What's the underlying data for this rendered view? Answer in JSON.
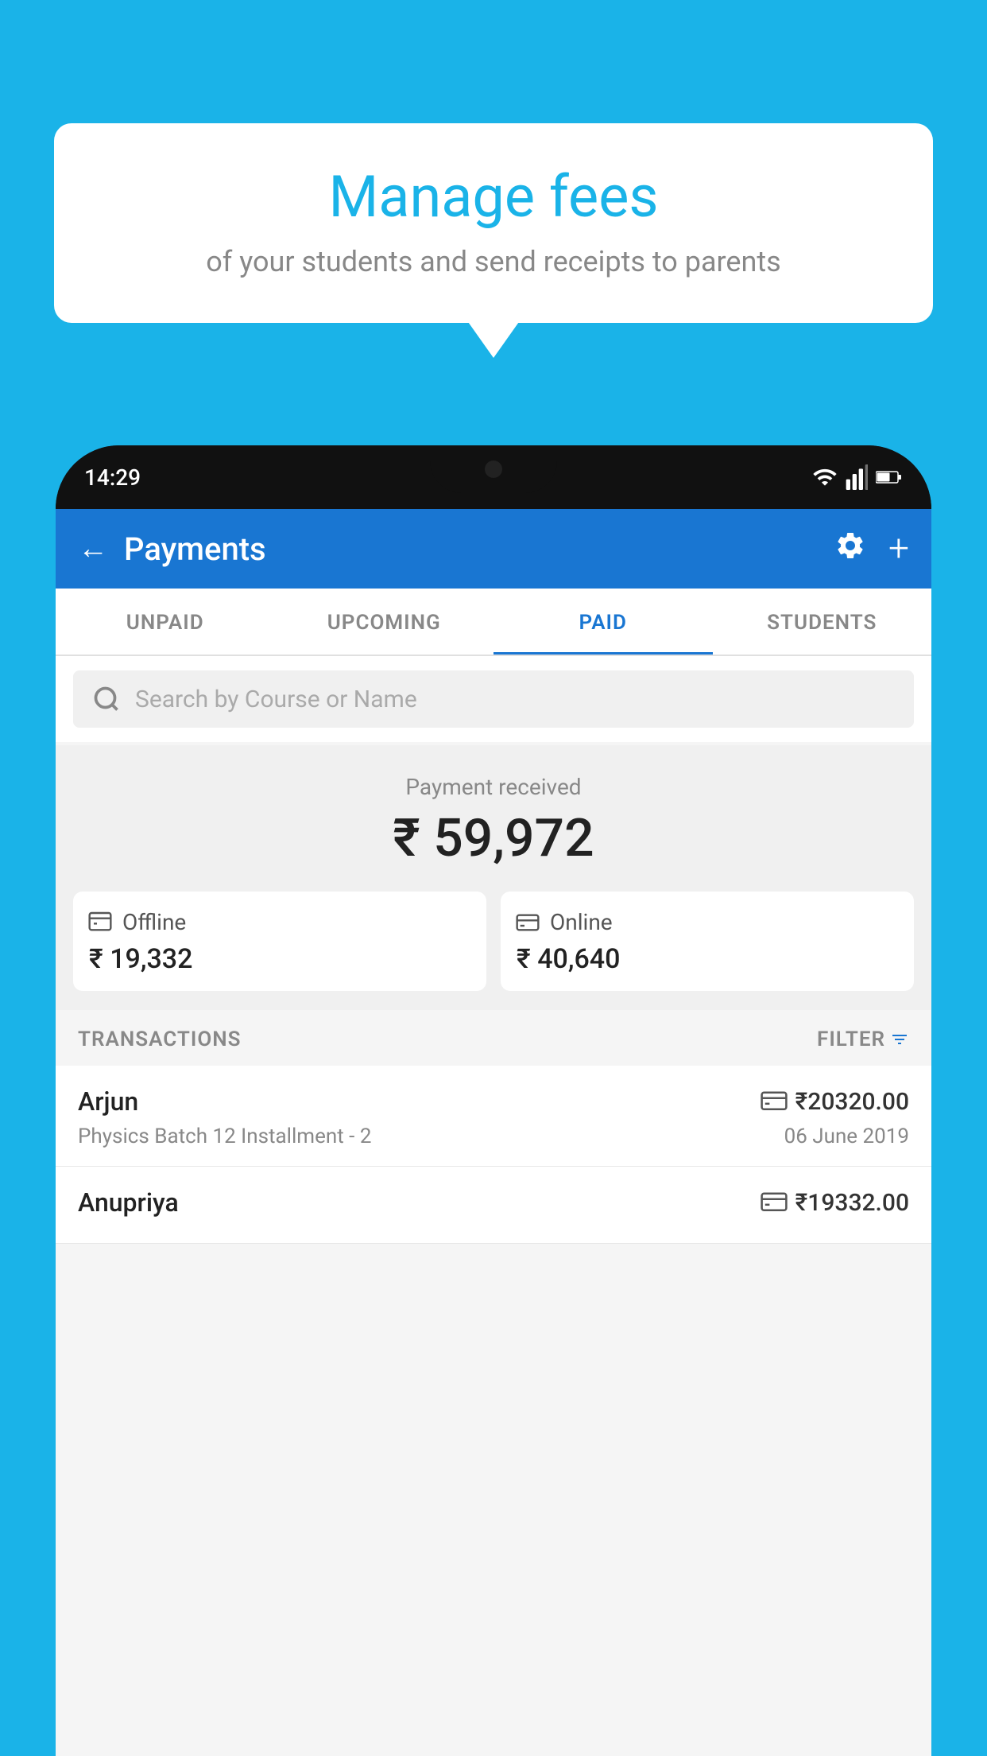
{
  "background_color": "#1ab3e8",
  "bubble": {
    "title": "Manage fees",
    "subtitle": "of your students and send receipts to parents"
  },
  "status_bar": {
    "time": "14:29"
  },
  "header": {
    "title": "Payments",
    "back_label": "←",
    "settings_label": "⚙",
    "add_label": "+"
  },
  "tabs": [
    {
      "label": "UNPAID",
      "active": false
    },
    {
      "label": "UPCOMING",
      "active": false
    },
    {
      "label": "PAID",
      "active": true
    },
    {
      "label": "STUDENTS",
      "active": false
    }
  ],
  "search": {
    "placeholder": "Search by Course or Name"
  },
  "payment_summary": {
    "label": "Payment received",
    "amount": "₹ 59,972",
    "offline": {
      "icon": "📄",
      "label": "Offline",
      "amount": "₹ 19,332"
    },
    "online": {
      "icon": "💳",
      "label": "Online",
      "amount": "₹ 40,640"
    }
  },
  "transactions": {
    "label": "TRANSACTIONS",
    "filter_label": "FILTER",
    "items": [
      {
        "name": "Arjun",
        "amount": "₹20320.00",
        "detail": "Physics Batch 12 Installment - 2",
        "date": "06 June 2019",
        "payment_type": "online"
      },
      {
        "name": "Anupriya",
        "amount": "₹19332.00",
        "detail": "",
        "date": "",
        "payment_type": "offline"
      }
    ]
  }
}
